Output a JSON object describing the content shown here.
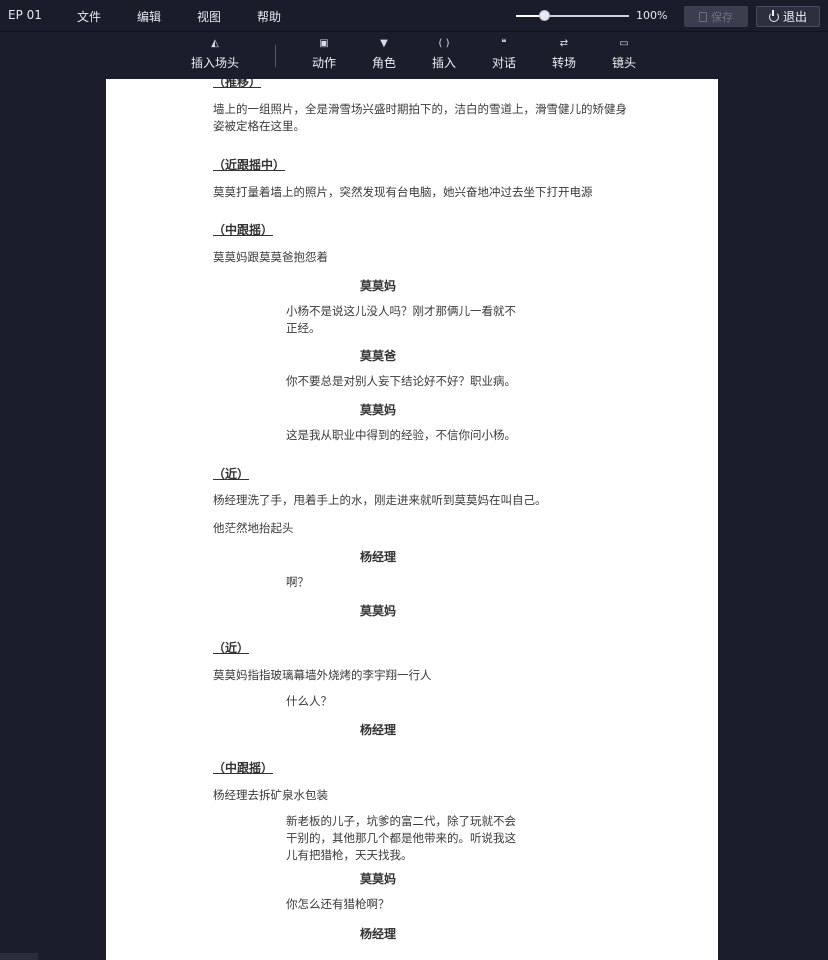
{
  "menubar": {
    "episode": "EP 01",
    "items": [
      "文件",
      "编辑",
      "视图",
      "帮助"
    ],
    "zoom": {
      "value_percent": 100,
      "label": "100%",
      "slider_fraction": 0.25
    },
    "save_label": "保存",
    "exit_label": "退出"
  },
  "toolbar": {
    "tools": [
      {
        "label": "插入场头",
        "icon": "scene-header-icon"
      },
      {
        "label": "动作",
        "icon": "action-icon"
      },
      {
        "label": "角色",
        "icon": "character-icon"
      },
      {
        "label": "插入",
        "icon": "parenthetical-icon"
      },
      {
        "label": "对话",
        "icon": "dialogue-icon"
      },
      {
        "label": "转场",
        "icon": "transition-icon"
      },
      {
        "label": "镜头",
        "icon": "camera-icon"
      }
    ]
  },
  "script": {
    "lines": [
      {
        "type": "shot",
        "text": "（推移）"
      },
      {
        "type": "action",
        "text": "墙上的一组照片，全是滑雪场兴盛时期拍下的，洁白的雪道上，滑雪健儿的矫健身\n姿被定格在这里。"
      },
      {
        "type": "shot",
        "text": "（近跟摇中）"
      },
      {
        "type": "action",
        "text": "莫莫打量着墙上的照片，突然发现有台电脑，她兴奋地冲过去坐下打开电源"
      },
      {
        "type": "shot",
        "text": "（中跟摇）"
      },
      {
        "type": "action",
        "text": "莫莫妈跟莫莫爸抱怨着"
      },
      {
        "type": "character",
        "text": "莫莫妈"
      },
      {
        "type": "dialogue",
        "text": "小杨不是说这儿没人吗？刚才那俩儿一看就不\n正经。"
      },
      {
        "type": "character",
        "text": "莫莫爸"
      },
      {
        "type": "dialogue",
        "text": "你不要总是对别人妄下结论好不好？职业病。"
      },
      {
        "type": "character",
        "text": "莫莫妈"
      },
      {
        "type": "dialogue",
        "text": "这是我从职业中得到的经验，不信你问小杨。"
      },
      {
        "type": "shot",
        "text": "（近）"
      },
      {
        "type": "action",
        "text": "杨经理洗了手，甩着手上的水，刚走进来就听到莫莫妈在叫自己。"
      },
      {
        "type": "action",
        "text": "他茫然地抬起头"
      },
      {
        "type": "character",
        "text": "杨经理"
      },
      {
        "type": "dialogue",
        "text": "啊？"
      },
      {
        "type": "character",
        "text": "莫莫妈"
      },
      {
        "type": "shot",
        "text": "（近）"
      },
      {
        "type": "action",
        "text": "莫莫妈指指玻璃幕墙外烧烤的李宇翔一行人"
      },
      {
        "type": "dialogue",
        "text": "什么人？"
      },
      {
        "type": "character",
        "text": "杨经理"
      },
      {
        "type": "shot",
        "text": "（中跟摇）"
      },
      {
        "type": "action",
        "text": "杨经理去拆矿泉水包装"
      },
      {
        "type": "dialogue",
        "text": "新老板的儿子，坑爹的富二代，除了玩就不会\n干别的，其他那几个都是他带来的。听说我这\n儿有把猎枪，天天找我。"
      },
      {
        "type": "character",
        "text": "莫莫妈"
      },
      {
        "type": "dialogue",
        "text": "你怎么还有猎枪啊？"
      },
      {
        "type": "character",
        "text": "杨经理"
      }
    ]
  }
}
